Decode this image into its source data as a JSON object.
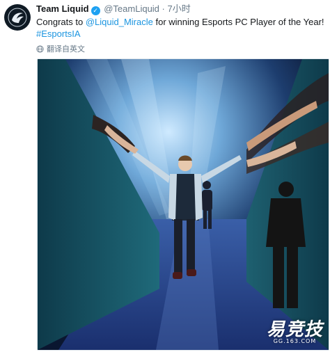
{
  "tweet": {
    "display_name": "Team Liquid",
    "handle": "@TeamLiquid",
    "separator": "·",
    "time": "7小时",
    "text_prefix": "Congrats to ",
    "mention": "@Liquid_Miracle",
    "text_suffix": " for winning Esports PC Player of the Year!",
    "hashtag": "#EsportsIA",
    "translate_label": "翻译自英文"
  },
  "media": {
    "watermark_main": "易竞技",
    "watermark_sub": "GG.163.COM"
  },
  "colors": {
    "link": "#1b95e0",
    "verified": "#1da1f2",
    "muted": "#657786"
  }
}
